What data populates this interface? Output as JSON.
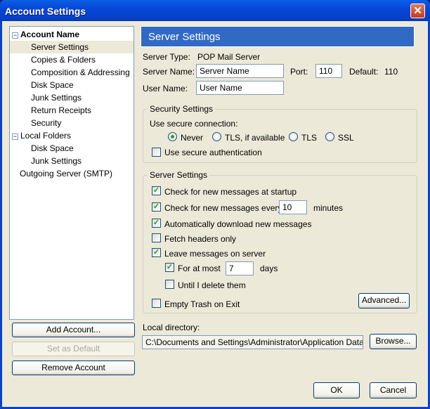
{
  "window": {
    "title": "Account Settings",
    "close_icon": "close-icon"
  },
  "tree": {
    "items": [
      {
        "label": "Account Name",
        "level": 0,
        "bold": true,
        "expander": "−"
      },
      {
        "label": "Server Settings",
        "level": 1,
        "selected": true
      },
      {
        "label": "Copies & Folders",
        "level": 1
      },
      {
        "label": "Composition & Addressing",
        "level": 1
      },
      {
        "label": "Disk Space",
        "level": 1
      },
      {
        "label": "Junk Settings",
        "level": 1
      },
      {
        "label": "Return Receipts",
        "level": 1
      },
      {
        "label": "Security",
        "level": 1
      },
      {
        "label": "Local Folders",
        "level": 0,
        "expander": "−"
      },
      {
        "label": "Disk Space",
        "level": 1
      },
      {
        "label": "Junk Settings",
        "level": 1
      },
      {
        "label": "Outgoing Server (SMTP)",
        "level": 0
      }
    ]
  },
  "left_buttons": {
    "add": "Add Account...",
    "default": "Set as Default",
    "remove": "Remove Account"
  },
  "panel": {
    "header": "Server Settings",
    "server_type_label": "Server Type:",
    "server_type_value": "POP Mail Server",
    "server_name_label": "Server Name:",
    "server_name_value": "Server Name",
    "port_label": "Port:",
    "port_value": "110",
    "default_label": "Default:",
    "default_value": "110",
    "user_name_label": "User Name:",
    "user_name_value": "User Name",
    "security": {
      "legend": "Security Settings",
      "connection_label": "Use secure connection:",
      "radios": [
        "Never",
        "TLS, if available",
        "TLS",
        "SSL"
      ],
      "selected": "Never",
      "secure_auth": {
        "label": "Use secure authentication",
        "checked": false
      }
    },
    "server": {
      "legend": "Server Settings",
      "check_startup": {
        "label": "Check for new messages at startup",
        "checked": true
      },
      "check_every": {
        "label": "Check for new messages every",
        "checked": true,
        "value": "10",
        "unit": "minutes"
      },
      "auto_download": {
        "label": "Automatically download new messages",
        "checked": true
      },
      "fetch_headers": {
        "label": "Fetch headers only",
        "checked": false
      },
      "leave_on_server": {
        "label": "Leave messages on server",
        "checked": true
      },
      "for_at_most": {
        "label": "For at most",
        "checked": true,
        "value": "7",
        "unit": "days"
      },
      "until_delete": {
        "label": "Until I delete them",
        "checked": false
      },
      "empty_trash": {
        "label": "Empty Trash on Exit",
        "checked": false
      },
      "advanced": "Advanced..."
    },
    "local_dir_label": "Local directory:",
    "local_dir_value": "C:\\Documents and Settings\\Administrator\\Application Data\\Thunderbird",
    "browse": "Browse..."
  },
  "footer": {
    "ok": "OK",
    "cancel": "Cancel"
  }
}
